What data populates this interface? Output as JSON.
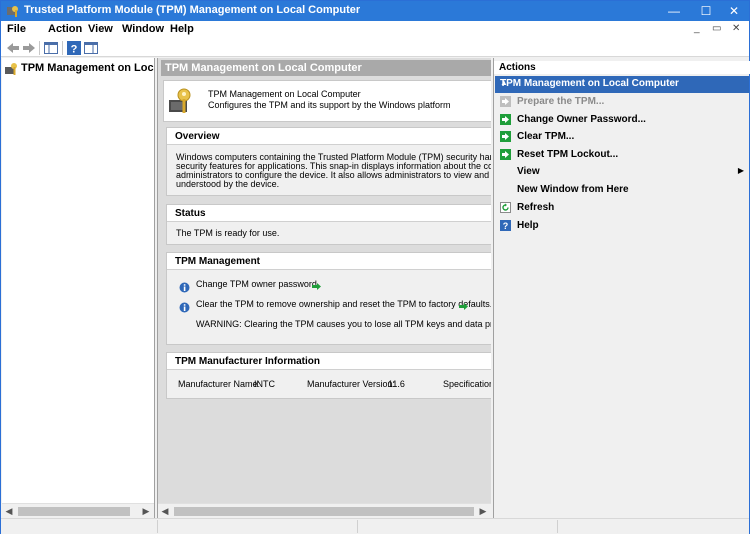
{
  "window": {
    "title": "Trusted Platform Module (TPM) Management on Local Computer",
    "controls": {
      "minimize": "—",
      "maximize": "☐",
      "close": "✕"
    }
  },
  "menu": {
    "items": [
      "File",
      "Action",
      "View",
      "Window",
      "Help"
    ],
    "mdi_controls": [
      "_",
      "▭",
      "✕"
    ]
  },
  "toolbar": {
    "buttons": [
      "back-icon",
      "forward-icon",
      "show-hide-tree-icon",
      "help-icon",
      "properties-icon"
    ]
  },
  "tree": {
    "root_label": "TPM Management on Local Computer"
  },
  "center": {
    "header": "TPM Management on Local Computer",
    "intro": {
      "title": "TPM Management on Local Computer",
      "description": "Configures the TPM and its support by the Windows platform"
    },
    "overview": {
      "title": "Overview",
      "lines": [
        "Windows computers containing the Trusted Platform Module (TPM) security hardware provid",
        "security features for applications. This snap-in displays information about the computer's TPM",
        "administrators to configure the device. It also allows administrators to view and manage comm",
        "understood by the device."
      ]
    },
    "status": {
      "title": "Status",
      "text": "The TPM is ready for use."
    },
    "tpm_management": {
      "title": "TPM Management",
      "change_owner": "Change TPM owner password.",
      "clear_tpm": "Clear the TPM to remove ownership and reset the TPM to factory defaults.",
      "warning": "WARNING: Clearing the TPM causes you to lose all TPM keys and data protected by"
    },
    "manufacturer": {
      "title": "TPM Manufacturer Information",
      "name_label": "Manufacturer Name:",
      "name_value": "INTC",
      "version_label": "Manufacturer Version:",
      "version_value": "11.6",
      "spec_label": "Specification V"
    }
  },
  "actions": {
    "header": "Actions",
    "group": "TPM Management on Local Computer",
    "items": [
      {
        "label": "Prepare the TPM...",
        "enabled": false,
        "icon": "green-arrow-icon"
      },
      {
        "label": "Change Owner Password...",
        "enabled": true,
        "icon": "green-arrow-icon"
      },
      {
        "label": "Clear TPM...",
        "enabled": true,
        "icon": "green-arrow-icon"
      },
      {
        "label": "Reset TPM Lockout...",
        "enabled": true,
        "icon": "green-arrow-icon"
      },
      {
        "label": "View",
        "enabled": true,
        "icon": "",
        "submenu": true
      },
      {
        "label": "New Window from Here",
        "enabled": true,
        "icon": ""
      },
      {
        "label": "Refresh",
        "enabled": true,
        "icon": "refresh-icon"
      },
      {
        "label": "Help",
        "enabled": true,
        "icon": "help-icon"
      }
    ]
  },
  "colors": {
    "titlebar": "#2b79d8",
    "actions_group": "#2f68b8",
    "center_header": "#a9a9a9",
    "action_icon_green": "#1f9e3a"
  }
}
